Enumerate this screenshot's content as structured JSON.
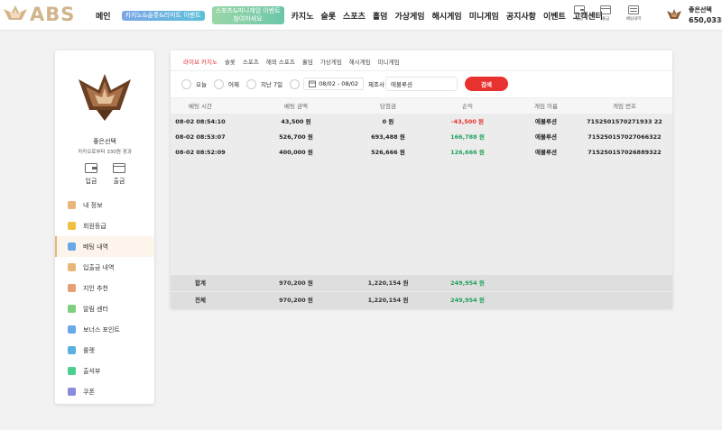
{
  "header": {
    "logo_text": "ABS",
    "nav": {
      "home": "메인",
      "promo1": "카지노&슬롯&리미트 이벤트",
      "promo2": "스포츠&미니게임 이벤트",
      "promo2_sub": "참여하세요",
      "casino": "카지노",
      "slot": "슬롯",
      "sports": "스포츠",
      "holdem": "홀덤",
      "virtual": "가상게임",
      "hash": "해시게임",
      "mini": "미니게임",
      "notice": "공지사항",
      "event": "이벤트",
      "support": "고객센터"
    },
    "utility": {
      "deposit": "입금",
      "withdraw": "출금",
      "history": "베팅내역"
    },
    "user": {
      "name": "좋은선택",
      "balance": "650,033"
    }
  },
  "sidebar": {
    "name": "좋은선택",
    "subtitle": "카카오로부터 330원 경과",
    "deposit": "입금",
    "withdraw": "출금",
    "menu": [
      {
        "label": "내 정보",
        "icon": "profile-icon",
        "color": "#e8b57a"
      },
      {
        "label": "회원등급",
        "icon": "grade-icon",
        "color": "#f0c040"
      },
      {
        "label": "베팅 내역",
        "icon": "bet-history-icon",
        "color": "#6aa8e8"
      },
      {
        "label": "입출금 내역",
        "icon": "transaction-icon",
        "color": "#e8b57a"
      },
      {
        "label": "지인 추천",
        "icon": "referral-icon",
        "color": "#e8a070"
      },
      {
        "label": "알림 센터",
        "icon": "notification-icon",
        "color": "#7fcf7f"
      },
      {
        "label": "보너스 포인트",
        "icon": "bonus-point-icon",
        "color": "#6aa8e8"
      },
      {
        "label": "룰렛",
        "icon": "roulette-icon",
        "color": "#5ab0e0"
      },
      {
        "label": "출석부",
        "icon": "attendance-icon",
        "color": "#4ccf8f"
      },
      {
        "label": "쿠폰",
        "icon": "coupon-icon",
        "color": "#8a8ae0"
      }
    ],
    "active_index": 2
  },
  "main": {
    "tabs": [
      "라이브 카지노",
      "슬롯",
      "스포츠",
      "해외 스포츠",
      "홀덤",
      "가상게임",
      "해시게임",
      "미니게임"
    ],
    "active_tab": 0,
    "filters": {
      "today": "오늘",
      "yesterday": "어제",
      "last7": "지난 7일",
      "date_range": "08/02 - 08/02",
      "search_label": "제조사",
      "search_value": "에볼루션",
      "search_button": "검색"
    },
    "table": {
      "headers": [
        "베팅 시간",
        "베팅 금액",
        "당첨금",
        "손익",
        "게임 이름",
        "게임 번호"
      ],
      "rows": [
        {
          "time": "08-02 08:54:10",
          "bet": "43,500 원",
          "win": "0 원",
          "profit": "-43,500 원",
          "game": "에볼루션",
          "number": "7152501570271933 22"
        },
        {
          "time": "08-02 08:53:07",
          "bet": "526,700 원",
          "win": "693,488 원",
          "profit": "166,788 원",
          "game": "에볼루션",
          "number": "715250157027066322"
        },
        {
          "time": "08-02 08:52:09",
          "bet": "400,000 원",
          "win": "526,666 원",
          "profit": "126,666 원",
          "game": "에볼루션",
          "number": "715250157026889322"
        }
      ],
      "footer": [
        {
          "label": "합계",
          "bet": "970,200 원",
          "win": "1,220,154 원",
          "profit": "249,954 원"
        },
        {
          "label": "전체",
          "bet": "970,200 원",
          "win": "1,220,154 원",
          "profit": "249,954 원"
        }
      ]
    }
  },
  "colors": {
    "accent": "#e8322f",
    "logo": "#d2b48c",
    "positive": "#21a15a",
    "negative": "#e8322f"
  }
}
